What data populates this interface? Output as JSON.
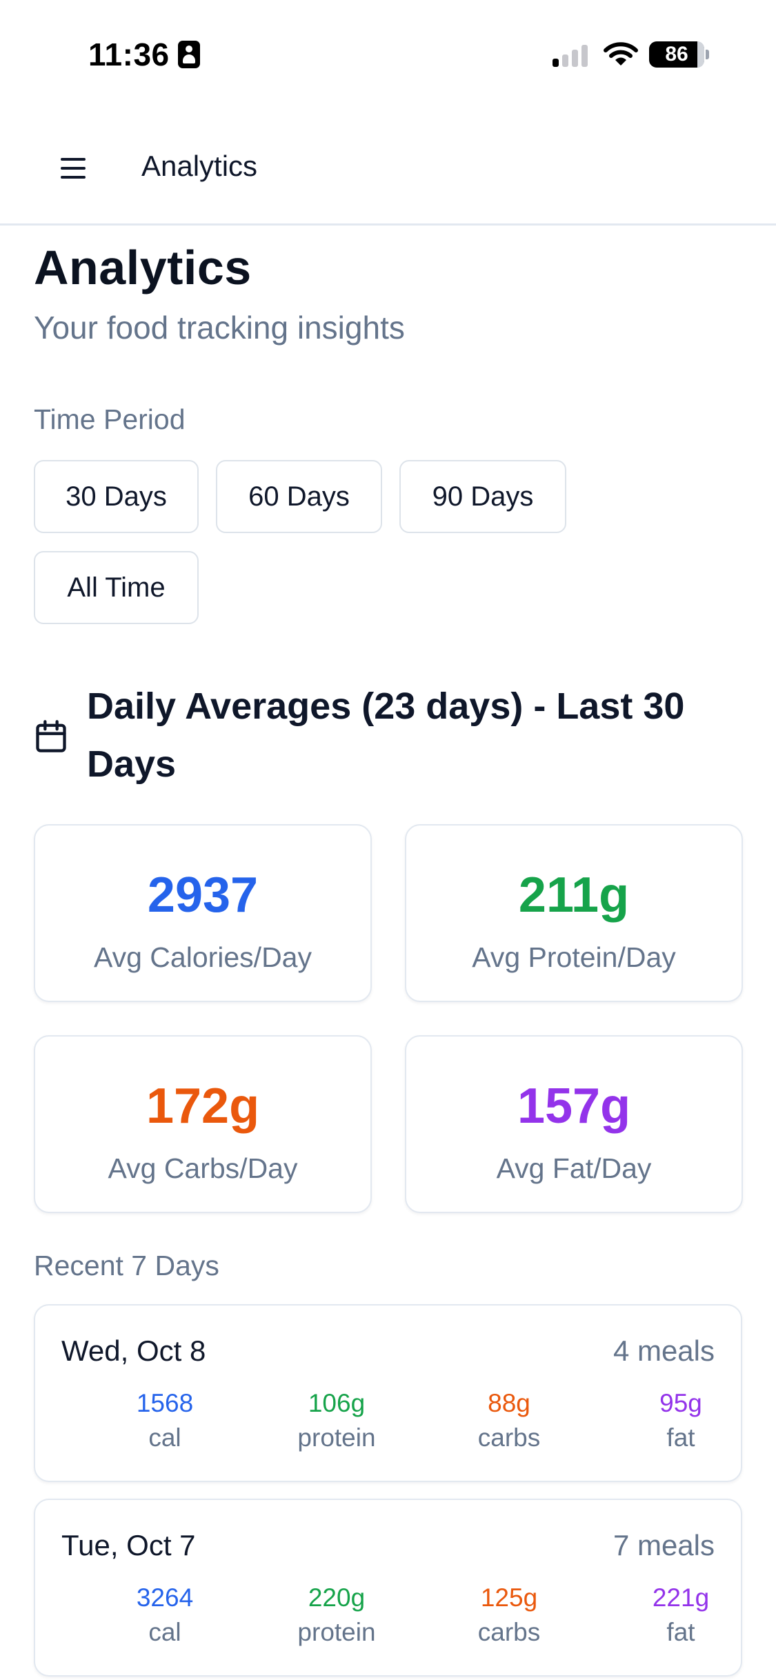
{
  "status_bar": {
    "time": "11:36",
    "battery": "86"
  },
  "header": {
    "title": "Analytics"
  },
  "main": {
    "title": "Analytics",
    "subtitle": "Your food tracking insights",
    "time_period_label": "Time Period",
    "periods": [
      {
        "label": "30 Days",
        "selected": true
      },
      {
        "label": "60 Days",
        "selected": false
      },
      {
        "label": "90 Days",
        "selected": false
      },
      {
        "label": "All Time",
        "selected": false
      }
    ],
    "averages_heading": "Daily Averages (23 days) - Last 30 Days",
    "stats": [
      {
        "value": "2937",
        "label": "Avg Calories/Day",
        "color": "#2563eb"
      },
      {
        "value": "211g",
        "label": "Avg Protein/Day",
        "color": "#16a34a"
      },
      {
        "value": "172g",
        "label": "Avg Carbs/Day",
        "color": "#ea580c"
      },
      {
        "value": "157g",
        "label": "Avg Fat/Day",
        "color": "#9333ea"
      }
    ],
    "recent_label": "Recent 7 Days",
    "recent_days": [
      {
        "date": "Wed, Oct 8",
        "meals": "4 meals",
        "cal": "1568",
        "cal_label": "cal",
        "protein": "106g",
        "protein_label": "protein",
        "carbs": "88g",
        "carbs_label": "carbs",
        "fat": "95g",
        "fat_label": "fat"
      },
      {
        "date": "Tue, Oct 7",
        "meals": "7 meals",
        "cal": "3264",
        "cal_label": "cal",
        "protein": "220g",
        "protein_label": "protein",
        "carbs": "125g",
        "carbs_label": "carbs",
        "fat": "221g",
        "fat_label": "fat"
      }
    ]
  },
  "colors": {
    "accent": "#f97316",
    "calories": "#2563eb",
    "protein": "#16a34a",
    "carbs": "#ea580c",
    "fat": "#9333ea",
    "muted_text": "#64748b"
  },
  "icons": [
    "person-icon",
    "signal-icon",
    "wifi-icon",
    "battery-icon",
    "menu-icon",
    "calendar-icon"
  ]
}
